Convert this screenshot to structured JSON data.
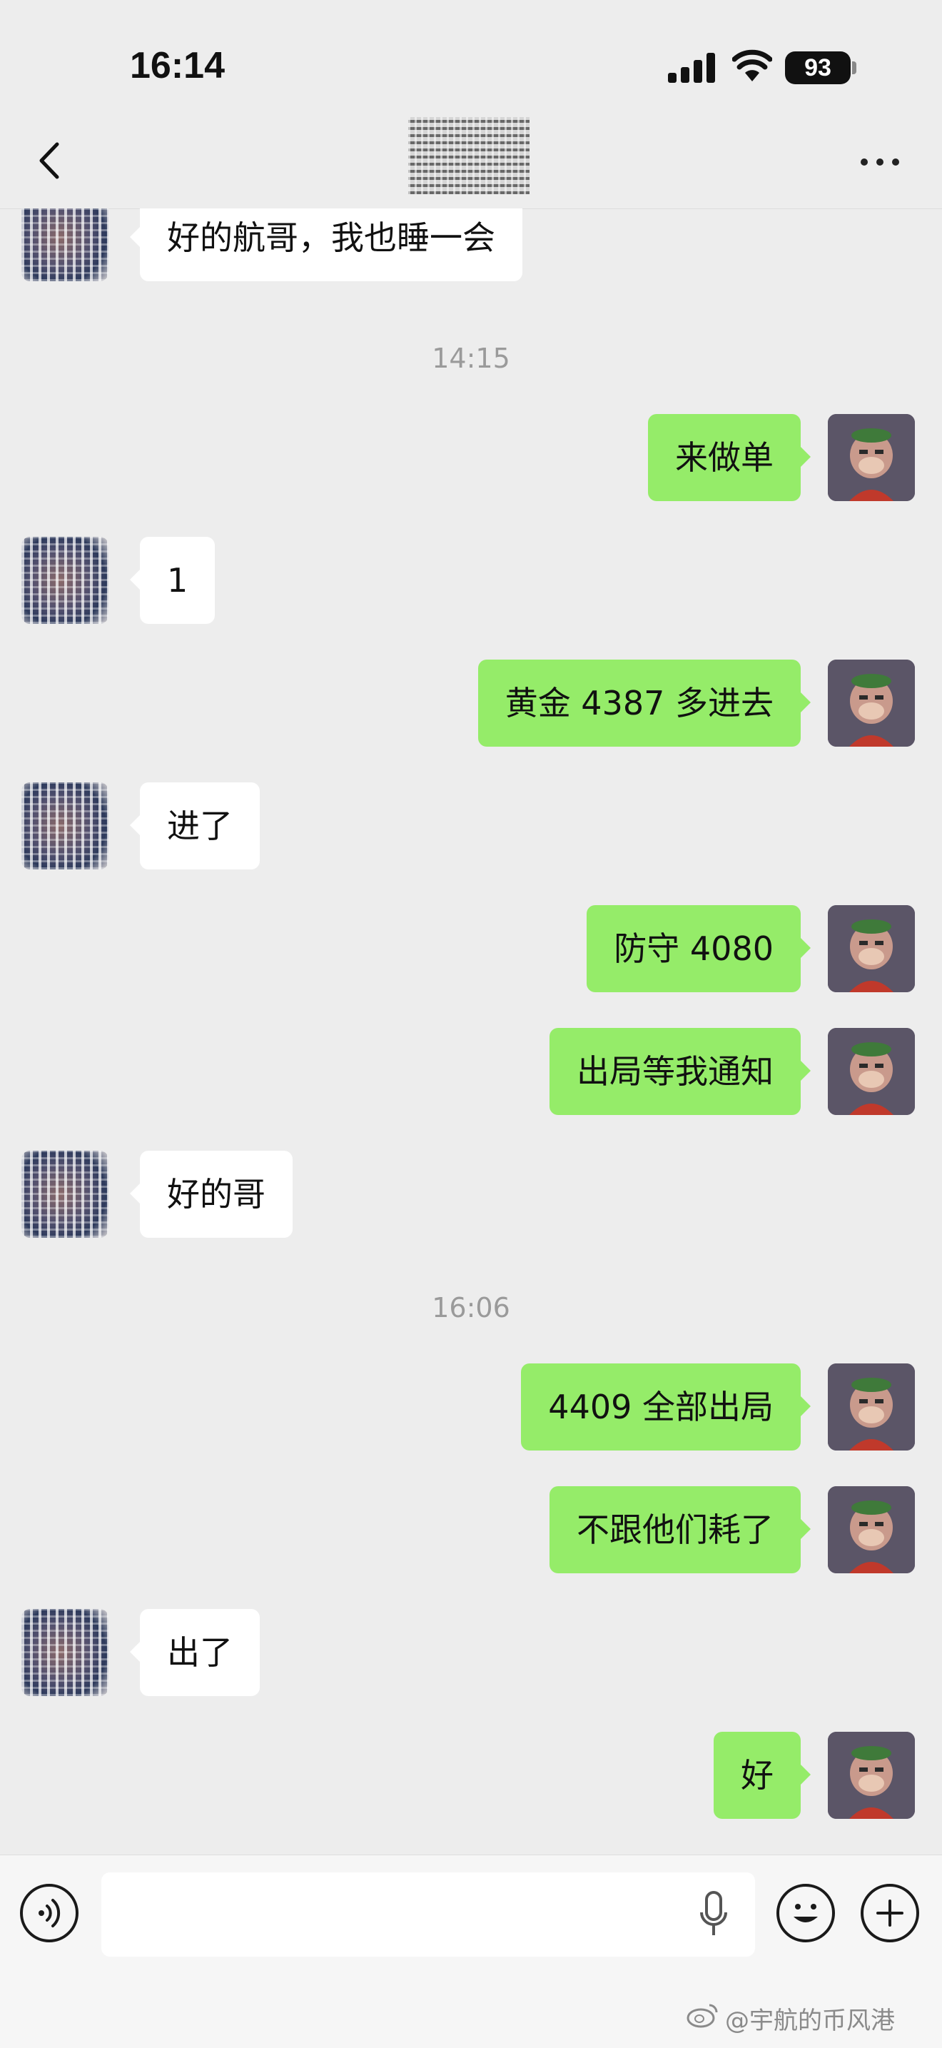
{
  "status_bar": {
    "time": "16:14",
    "battery": "93"
  },
  "nav": {
    "title": ""
  },
  "messages": [
    {
      "type": "in",
      "text": "好的航哥，我也睡一会"
    },
    {
      "type": "time",
      "text": "14:15"
    },
    {
      "type": "out",
      "text": "来做单"
    },
    {
      "type": "in",
      "text": "1"
    },
    {
      "type": "out",
      "text": "黄金 4387 多进去"
    },
    {
      "type": "in",
      "text": "进了"
    },
    {
      "type": "out",
      "text": "防守 4080"
    },
    {
      "type": "out",
      "text": "出局等我通知"
    },
    {
      "type": "in",
      "text": "好的哥"
    },
    {
      "type": "time",
      "text": "16:06"
    },
    {
      "type": "out",
      "text": "4409 全部出局"
    },
    {
      "type": "out",
      "text": "不跟他们耗了"
    },
    {
      "type": "in",
      "text": "出了"
    },
    {
      "type": "out",
      "text": "好"
    }
  ],
  "input_bar": {
    "value": "",
    "placeholder": ""
  },
  "watermark": "@宇航的币风港",
  "colors": {
    "outgoing_bubble": "#95ec69",
    "incoming_bubble": "#ffffff",
    "background": "#ededed"
  }
}
